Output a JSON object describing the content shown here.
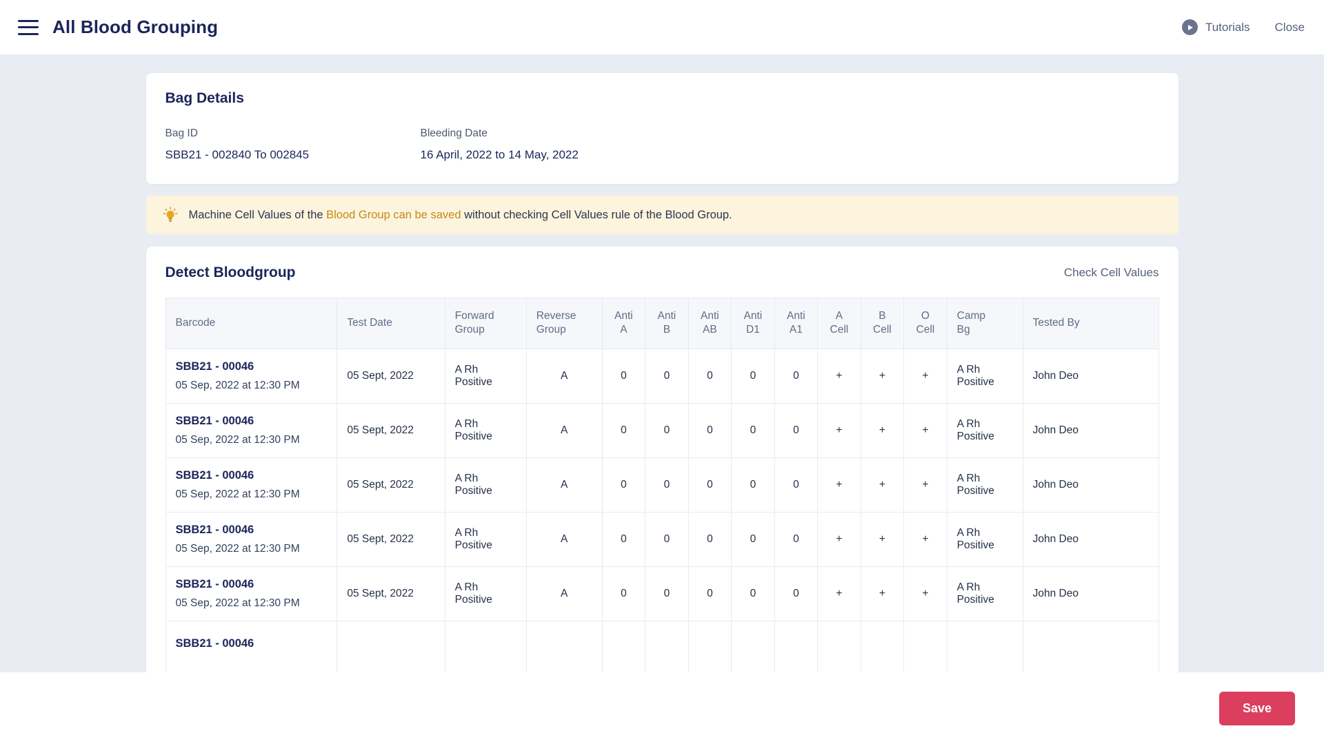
{
  "header": {
    "menu_icon": "hamburger-icon",
    "title": "All Blood Grouping",
    "tutorials_label": "Tutorials",
    "tutorials_icon": "play-circle-icon",
    "close_label": "Close"
  },
  "bag_details": {
    "title": "Bag Details",
    "fields": [
      {
        "label": "Bag ID",
        "value": "SBB21 - 002840 To 002845"
      },
      {
        "label": "Bleeding Date",
        "value": "16 April, 2022 to 14 May, 2022"
      }
    ]
  },
  "banner": {
    "icon": "lightbulb-icon",
    "text_before": "Machine Cell Values of the ",
    "text_highlight": "Blood Group can be saved",
    "text_after": " without checking Cell Values rule of the Blood Group.",
    "highlight_color": "#c28a18",
    "background_color": "#fdf4dd"
  },
  "detect": {
    "title": "Detect Bloodgroup",
    "check_cell_values_label": "Check Cell Values",
    "columns": [
      "Barcode",
      "Test Date",
      "Forward Group",
      "Reverse Group",
      "Anti A",
      "Anti B",
      "Anti AB",
      "Anti D1",
      "Anti A1",
      "A Cell",
      "B Cell",
      "O Cell",
      "Camp Bg",
      "Tested By"
    ],
    "columns_wrapped": [
      [
        "Barcode",
        ""
      ],
      [
        "Test Date",
        ""
      ],
      [
        "Forward",
        "Group"
      ],
      [
        "Reverse",
        "Group"
      ],
      [
        "Anti",
        "A"
      ],
      [
        "Anti",
        "B"
      ],
      [
        "Anti",
        "AB"
      ],
      [
        "Anti",
        "D1"
      ],
      [
        "Anti",
        "A1"
      ],
      [
        "A",
        "Cell"
      ],
      [
        "B",
        "Cell"
      ],
      [
        "O",
        "Cell"
      ],
      [
        "Camp",
        "Bg"
      ],
      [
        "Tested By",
        ""
      ]
    ],
    "rows": [
      {
        "barcode": "SBB21 - 00046",
        "barcode_time": "05 Sep, 2022 at 12:30 PM",
        "test_date": "05 Sept, 2022",
        "forward_group": "A Rh Positive",
        "reverse_group": "A",
        "anti_a": "0",
        "anti_b": "0",
        "anti_ab": "0",
        "anti_d1": "0",
        "anti_a1": "0",
        "a_cell": "+",
        "b_cell": "+",
        "o_cell": "+",
        "camp_bg": "A Rh Positive",
        "tested_by": "John Deo"
      },
      {
        "barcode": "SBB21 - 00046",
        "barcode_time": "05 Sep, 2022 at 12:30 PM",
        "test_date": "05 Sept, 2022",
        "forward_group": "A Rh Positive",
        "reverse_group": "A",
        "anti_a": "0",
        "anti_b": "0",
        "anti_ab": "0",
        "anti_d1": "0",
        "anti_a1": "0",
        "a_cell": "+",
        "b_cell": "+",
        "o_cell": "+",
        "camp_bg": "A Rh Positive",
        "tested_by": "John Deo"
      },
      {
        "barcode": "SBB21 - 00046",
        "barcode_time": "05 Sep, 2022 at 12:30 PM",
        "test_date": "05 Sept, 2022",
        "forward_group": "A Rh Positive",
        "reverse_group": "A",
        "anti_a": "0",
        "anti_b": "0",
        "anti_ab": "0",
        "anti_d1": "0",
        "anti_a1": "0",
        "a_cell": "+",
        "b_cell": "+",
        "o_cell": "+",
        "camp_bg": "A Rh Positive",
        "tested_by": "John Deo"
      },
      {
        "barcode": "SBB21 - 00046",
        "barcode_time": "05 Sep, 2022 at 12:30 PM",
        "test_date": "05 Sept, 2022",
        "forward_group": "A Rh Positive",
        "reverse_group": "A",
        "anti_a": "0",
        "anti_b": "0",
        "anti_ab": "0",
        "anti_d1": "0",
        "anti_a1": "0",
        "a_cell": "+",
        "b_cell": "+",
        "o_cell": "+",
        "camp_bg": "A Rh Positive",
        "tested_by": "John Deo"
      },
      {
        "barcode": "SBB21 - 00046",
        "barcode_time": "05 Sep, 2022 at 12:30 PM",
        "test_date": "05 Sept, 2022",
        "forward_group": "A Rh Positive",
        "reverse_group": "A",
        "anti_a": "0",
        "anti_b": "0",
        "anti_ab": "0",
        "anti_d1": "0",
        "anti_a1": "0",
        "a_cell": "+",
        "b_cell": "+",
        "o_cell": "+",
        "camp_bg": "A Rh Positive",
        "tested_by": "John Deo"
      },
      {
        "barcode": "SBB21 - 00046",
        "barcode_time": "",
        "test_date": "",
        "forward_group": "",
        "reverse_group": "",
        "anti_a": "",
        "anti_b": "",
        "anti_ab": "",
        "anti_d1": "",
        "anti_a1": "",
        "a_cell": "",
        "b_cell": "",
        "o_cell": "",
        "camp_bg": "",
        "tested_by": ""
      }
    ]
  },
  "footer": {
    "save_label": "Save",
    "save_color": "#dc3e5e"
  }
}
